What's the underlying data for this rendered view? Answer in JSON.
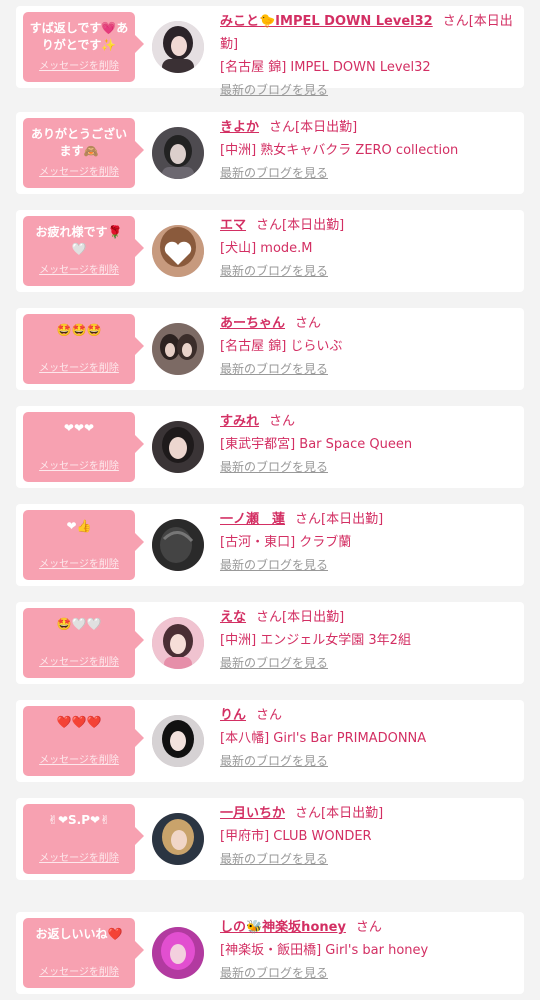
{
  "delete_label": "メッセージを削除",
  "blog_label": "最新のブログを見る",
  "san_label": "さん",
  "colors": {
    "bubble": "#f7a1b1",
    "accent": "#d32f63",
    "muted": "#999999",
    "background": "#f3f3f3"
  },
  "rows": [
    {
      "message": "すば返しです💗ありがとです✨",
      "name": "みこと🐤IMPEL DOWN Level32",
      "badge": "[本日出勤]",
      "shop": "[名古屋 錦] IMPEL DOWN Level32",
      "avatar_icon": "girl-avatar-icon"
    },
    {
      "message": "ありがとうございます🙈",
      "name": "きよか",
      "badge": "[本日出勤]",
      "shop": "[中洲] 熟女キャバクラ ZERO collection",
      "avatar_icon": "girl-avatar-icon"
    },
    {
      "message": "お疲れ様です🌹🤍",
      "name": "エマ",
      "badge": "[本日出勤]",
      "shop": "[犬山] mode.M",
      "avatar_icon": "heart-cover-avatar-icon"
    },
    {
      "message": "🤩🤩🤩",
      "name": "あーちゃん",
      "badge": "",
      "shop": "[名古屋 錦] じらいぶ",
      "avatar_icon": "girl-avatar-icon"
    },
    {
      "message": "❤❤❤",
      "name": "すみれ",
      "badge": "",
      "shop": "[東武宇都宮] Bar Space Queen",
      "avatar_icon": "girl-avatar-icon"
    },
    {
      "message": "❤👍",
      "name": "一ノ瀬　蓮",
      "badge": "[本日出勤]",
      "shop": "[古河・東口] クラブ蘭",
      "avatar_icon": "girl-avatar-icon"
    },
    {
      "message": "🤩🤍🤍",
      "name": "えな",
      "badge": "[本日出勤]",
      "shop": "[中洲] エンジェル女学園 3年2組",
      "avatar_icon": "girl-avatar-icon"
    },
    {
      "message": "❤️❤️❤️",
      "name": "りん",
      "badge": "",
      "shop": "[本八幡] Girl's Bar PRIMADONNA",
      "avatar_icon": "girl-avatar-icon"
    },
    {
      "message": "✌❤S.P❤✌",
      "name": "一月いちか",
      "badge": "[本日出勤]",
      "shop": "[甲府市] CLUB WONDER",
      "avatar_icon": "girl-avatar-icon"
    },
    {
      "message": "お返しいいね❤️",
      "name": "しの🐝神楽坂honey",
      "badge": "",
      "shop": "[神楽坂・飯田橋] Girl's bar honey",
      "avatar_icon": "girl-avatar-icon"
    }
  ]
}
